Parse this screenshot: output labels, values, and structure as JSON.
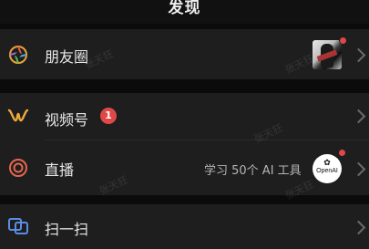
{
  "header": {
    "title": "发现"
  },
  "items": [
    {
      "label": "朋友圈",
      "icon": "moments-aperture-icon"
    },
    {
      "label": "视频号",
      "icon": "channels-icon",
      "badge": "1"
    },
    {
      "label": "直播",
      "icon": "live-icon",
      "promo_text": "学习 50个 AI 工具",
      "promo_logo": "OpenAI"
    },
    {
      "label": "扫一扫",
      "icon": "scan-icon"
    }
  ],
  "watermark": "张天狂",
  "colors": {
    "background": "#111111",
    "row": "#1e1e1e",
    "badge": "#e04848"
  }
}
